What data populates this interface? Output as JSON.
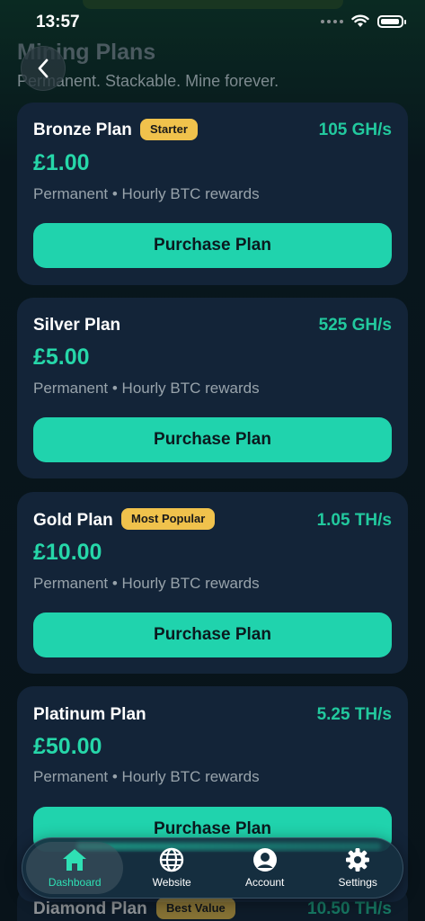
{
  "status": {
    "time": "13:57"
  },
  "header": {
    "title": "Mining Plans",
    "subtitle": "Permanent. Stackable. Mine forever."
  },
  "common": {
    "purchase_label": "Purchase Plan",
    "description": "Permanent • Hourly BTC rewards"
  },
  "plans": [
    {
      "name": "Bronze Plan",
      "badge": "Starter",
      "rate": "105 GH/s",
      "price": "£1.00"
    },
    {
      "name": "Silver Plan",
      "badge": "",
      "rate": "525 GH/s",
      "price": "£5.00"
    },
    {
      "name": "Gold Plan",
      "badge": "Most Popular",
      "rate": "1.05 TH/s",
      "price": "£10.00"
    },
    {
      "name": "Platinum Plan",
      "badge": "",
      "rate": "5.25 TH/s",
      "price": "£50.00"
    },
    {
      "name": "Diamond Plan",
      "badge": "Best Value",
      "rate": "10.50 TH/s",
      "price": ""
    }
  ],
  "tabs": [
    {
      "label": "Dashboard",
      "icon": "home-icon",
      "active": true
    },
    {
      "label": "Website",
      "icon": "globe-icon",
      "active": false
    },
    {
      "label": "Account",
      "icon": "user-icon",
      "active": false
    },
    {
      "label": "Settings",
      "icon": "gear-icon",
      "active": false
    }
  ],
  "colors": {
    "accent": "#20d3ad",
    "badge": "#f0c24c",
    "card": "#132438"
  }
}
